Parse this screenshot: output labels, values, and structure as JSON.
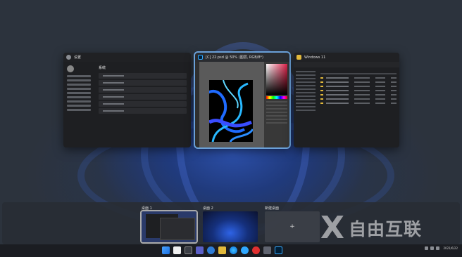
{
  "windows": [
    {
      "title": "设置",
      "icon": "settings-gear-icon",
      "content_title": "系统"
    },
    {
      "title": "[C] 22.psd @ 50% (图层, RGB/8*)",
      "icon": "photoshop-icon"
    },
    {
      "title": "Windows 11",
      "icon": "folder-icon"
    }
  ],
  "desktops": {
    "items": [
      {
        "label": "桌面 1"
      },
      {
        "label": "桌面 2"
      }
    ],
    "new_label": "新建桌面",
    "new_symbol": "+"
  },
  "taskbar": {
    "clock_time": "",
    "clock_date": "2021/6/22"
  },
  "watermark": {
    "text": "自由互联",
    "mark": "X"
  },
  "colors": {
    "accent": "#6aa0d8",
    "ps_blue": "#001e36",
    "folder": "#e2b93b"
  }
}
